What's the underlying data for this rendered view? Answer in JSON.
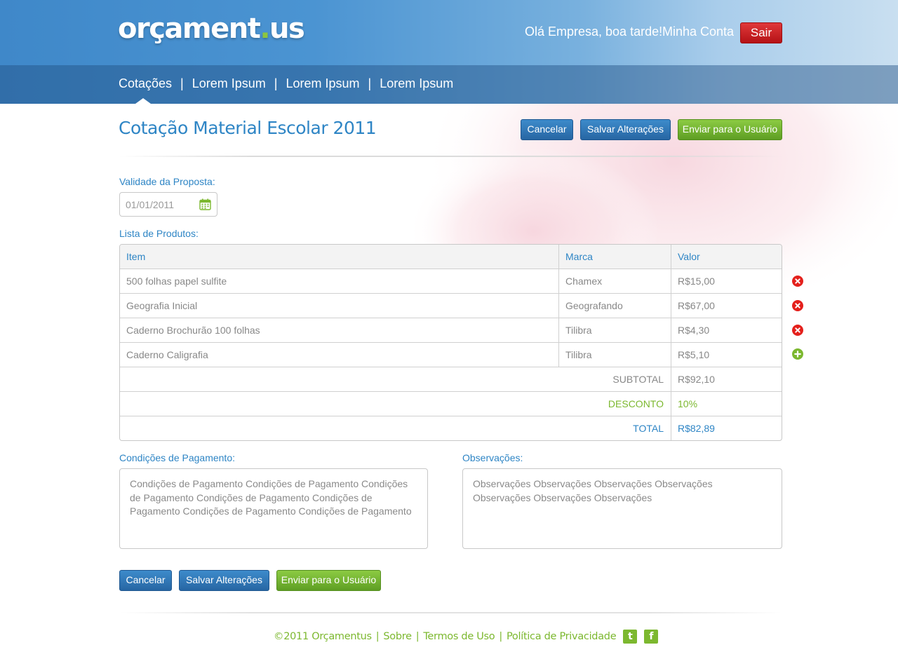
{
  "header": {
    "logo_text_main": "orçament",
    "logo_text_dot": ".",
    "logo_text_end": "us",
    "greeting": "Olá Empresa, boa tarde!",
    "account_link": "Minha Conta",
    "logout_label": "Sair"
  },
  "nav": {
    "items": [
      {
        "label": "Cotações"
      },
      {
        "label": "Lorem Ipsum"
      },
      {
        "label": "Lorem Ipsum"
      },
      {
        "label": "Lorem Ipsum"
      }
    ],
    "separator": "|",
    "active_index": 0
  },
  "page": {
    "title": "Cotação Material Escolar 2011",
    "actions": {
      "cancel": "Cancelar",
      "save": "Salvar Alterações",
      "send": "Enviar para o Usuário"
    }
  },
  "validity": {
    "label": "Validade da Proposta:",
    "value": "01/01/2011",
    "icon": "calendar-icon"
  },
  "products": {
    "label": "Lista de Produtos:",
    "columns": {
      "item": "Item",
      "brand": "Marca",
      "value": "Valor"
    },
    "rows": [
      {
        "item": "500 folhas papel sulfite",
        "brand": "Chamex",
        "value": "R$15,00",
        "action": "remove"
      },
      {
        "item": "Geografia Inicial",
        "brand": "Geografando",
        "value": "R$67,00",
        "action": "remove"
      },
      {
        "item": "Caderno Brochurão 100 folhas",
        "brand": "Tilibra",
        "value": "R$4,30",
        "action": "remove"
      },
      {
        "item": "Caderno Caligrafia",
        "brand": "Tilibra",
        "value": "R$5,10",
        "action": "add"
      }
    ],
    "subtotal": {
      "label": "SUBTOTAL",
      "value": "R$92,10"
    },
    "discount": {
      "label": "DESCONTO",
      "value": "10%"
    },
    "total": {
      "label": "TOTAL",
      "value": "R$82,89"
    }
  },
  "payment": {
    "label": "Condições de Pagamento:",
    "value": "Condições de Pagamento Condições de Pagamento Condições de Pagamento Condições de Pagamento Condições de Pagamento Condições de Pagamento Condições de Pagamento"
  },
  "notes": {
    "label": "Observações:",
    "value": "Observações Observações Observações Observações Observações Observações Observações"
  },
  "bottom_actions": {
    "cancel": "Cancelar",
    "save": "Salvar Alterações",
    "send": "Enviar para o Usuário"
  },
  "footer": {
    "copyright": "©2011 Orçamentus",
    "links": [
      "Sobre",
      "Termos de Uso",
      "Política de Privacidade"
    ],
    "separator": "|",
    "social": [
      {
        "name": "twitter-icon",
        "glyph": "t"
      },
      {
        "name": "facebook-icon",
        "glyph": "f"
      }
    ]
  },
  "colors": {
    "brand_blue": "#2e85c5",
    "brand_green": "#7cb82f",
    "danger_red": "#e4201c"
  }
}
